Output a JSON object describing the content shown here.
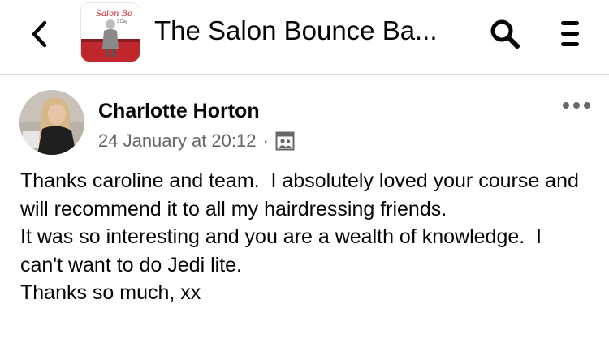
{
  "header": {
    "group_title": "The Salon Bounce Ba...",
    "thumbnail_text": "Salon Bo",
    "thumbnail_subtext": "3 Day",
    "back_icon": "chevron-left-icon",
    "search_icon": "search-icon",
    "menu_icon": "hamburger-menu-icon"
  },
  "post": {
    "author": "Charlotte Horton",
    "timestamp": "24 January at 20:12",
    "separator": "·",
    "audience_icon": "group-audience-icon",
    "more_icon": "more-options-icon",
    "lines": [
      "Thanks caroline and team.  I absolutely loved your course and will recommend it to all my hairdressing friends.",
      "It was so interesting and you are a wealth of knowledge.  I can't want to do Jedi lite.",
      "Thanks so much, xx"
    ]
  },
  "colors": {
    "text": "#050505",
    "secondary": "#65676b",
    "divider": "#dadde1",
    "thumb_red": "#c0272d"
  }
}
